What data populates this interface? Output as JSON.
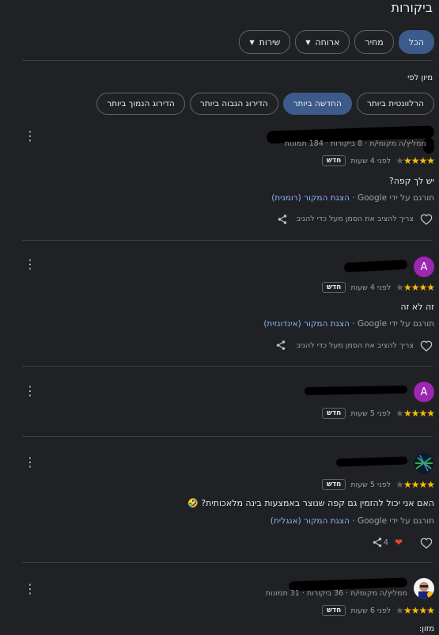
{
  "title": "ביקורות",
  "filters": [
    {
      "label": "הכל",
      "active": true,
      "dropdown": false
    },
    {
      "label": "מחיר",
      "active": false,
      "dropdown": false
    },
    {
      "label": "ארוחה",
      "active": false,
      "dropdown": true
    },
    {
      "label": "שירות",
      "active": false,
      "dropdown": true
    }
  ],
  "sort": {
    "label": "מיון לפי",
    "options": [
      "הרלוונטית ביותר",
      "החדשה ביותר",
      "הדירוג הגבוה ביותר",
      "הדירוג הנמוך ביותר"
    ],
    "active": "החדשה ביותר"
  },
  "colors": {
    "accent": "#8ab4f8",
    "star": "#fbbc04",
    "chip_active": "#3c5a8a",
    "heart": "#ea4335"
  },
  "reviews": [
    {
      "meta": "ממליץ/ה מקומי/ת · 8 ביקורות · 184 תמונות",
      "stars": "★★★★",
      "time": "לפני 4 שעות",
      "badge": "חדש",
      "text": "יש לך קפה?",
      "translated_by": "תורגם על ידי Google · ",
      "show_original": "הצגת המקור (רומנית)",
      "like_hint": "צריך להציב את הסמן מעל כדי להגיב"
    },
    {
      "avatar_letter": "A",
      "stars": "★★★★",
      "time": "לפני 4 שעות",
      "badge": "חדש",
      "text": "זה לא זה",
      "translated_by": "תורגם על ידי Google · ",
      "show_original": "הצגת המקור (אינדונזית)",
      "like_hint": "צריך להציב את הסמן מעל כדי להגיב"
    },
    {
      "avatar_letter": "A",
      "stars": "★★★★",
      "time": "לפני 5 שעות",
      "badge": "חדש"
    },
    {
      "stars": "★★★★",
      "time": "לפני 5 שעות",
      "badge": "חדש",
      "text": "האם אני יכול להזמין גם קפה שנוצר באמצעות בינה מלאכותית? 🤣",
      "translated_by": "תורגם על ידי Google · ",
      "show_original": "הצגת המקור (אנגלית)",
      "like_count": "4"
    },
    {
      "meta": "ממליץ/ה מקומי/ת · 36 ביקורות · 31 תמונות",
      "stars": "★★★★",
      "time": "לפני 6 שעות",
      "badge": "חדש",
      "text": "מזון:"
    }
  ]
}
